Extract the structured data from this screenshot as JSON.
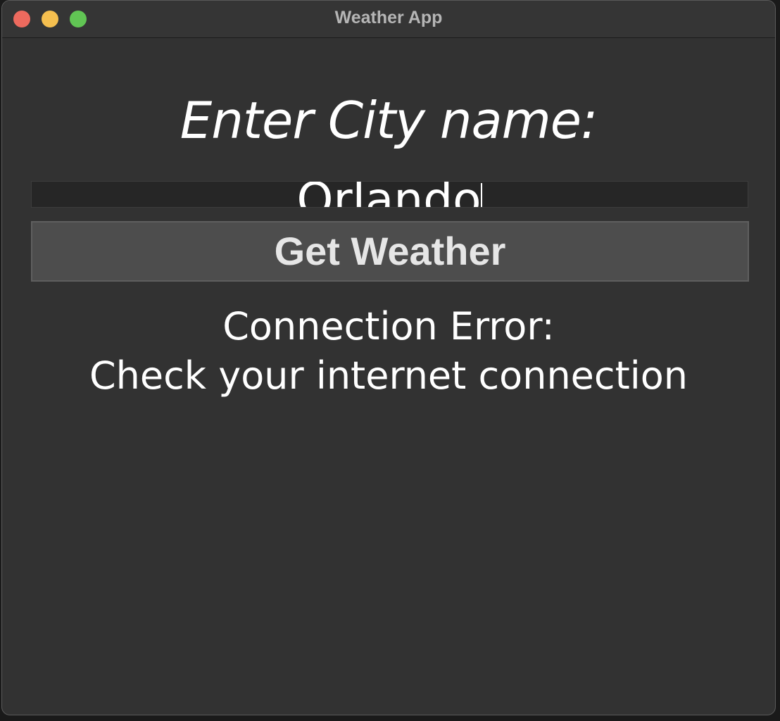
{
  "window": {
    "title": "Weather App"
  },
  "prompt": {
    "label": "Enter City name:"
  },
  "city_input": {
    "value": "Orlando"
  },
  "actions": {
    "get_weather_label": "Get Weather"
  },
  "status": {
    "line1": "Connection Error:",
    "line2": "Check your internet connection"
  },
  "icons": {
    "close": "close-traffic-light",
    "minimize": "minimize-traffic-light",
    "maximize": "maximize-traffic-light"
  },
  "colors": {
    "window_bg": "#323232",
    "close": "#ed6a5e",
    "minimize": "#f5bf4f",
    "maximize": "#61c554",
    "button_bg": "#4d4d4d"
  }
}
